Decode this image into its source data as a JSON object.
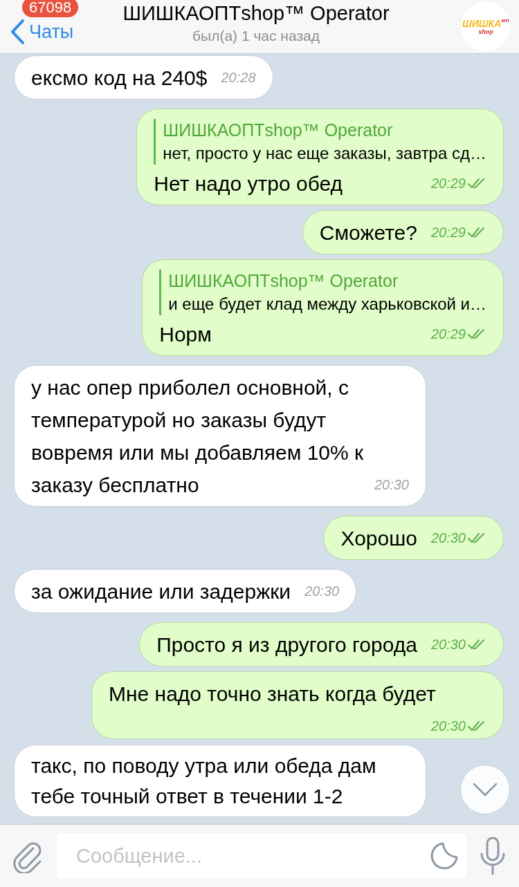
{
  "header": {
    "back_label": "Чаты",
    "unread_badge": "67098",
    "title": "ШИШКАОПТshop™ Operator",
    "status": "был(а) 1 час назад",
    "avatar": {
      "logo_text": "ШИШКА",
      "logo_sub": "shop",
      "logo_badge": "опт"
    }
  },
  "messages": [
    {
      "kind": "incoming",
      "text": "ексмо код на 240$",
      "time": "20:28"
    },
    {
      "kind": "outgoing",
      "reply": {
        "name": "ШИШКАОПТshop™ Operator",
        "text": "нет, просто у нас еще заказы, завтра сд…"
      },
      "text": "Нет надо утро обед",
      "time": "20:29",
      "read": true
    },
    {
      "kind": "outgoing",
      "text": "Сможете?",
      "time": "20:29",
      "read": true
    },
    {
      "kind": "outgoing",
      "reply": {
        "name": "ШИШКАОПТshop™ Operator",
        "text": "и еще будет клад между харьковской и…"
      },
      "text": "Норм",
      "time": "20:29",
      "read": true
    },
    {
      "kind": "incoming",
      "text": "у нас опер приболел основной, с температурой но заказы будут вовремя или мы добавляем 10% к заказу бесплатно",
      "time": "20:30"
    },
    {
      "kind": "outgoing",
      "text": "Хорошо",
      "time": "20:30",
      "read": true
    },
    {
      "kind": "incoming",
      "text": "за ожидание или задержки",
      "time": "20:30"
    },
    {
      "kind": "outgoing",
      "text": "Просто я из другого города",
      "time": "20:30",
      "read": true
    },
    {
      "kind": "outgoing",
      "text": "Мне надо точно знать когда будет",
      "time": "20:30",
      "read": true
    },
    {
      "kind": "incoming",
      "text": "такс, по поводу утра или обеда дам тебе точный ответ в течении 1-2"
    }
  ],
  "composer": {
    "placeholder": "Сообщение..."
  }
}
